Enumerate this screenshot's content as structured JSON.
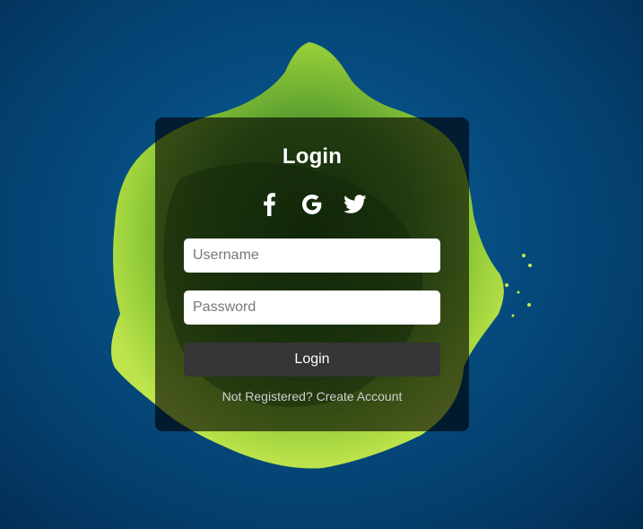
{
  "login_card": {
    "title": "Login",
    "social_icons": [
      "facebook-icon",
      "google-icon",
      "twitter-icon"
    ],
    "username": {
      "placeholder": "Username",
      "value": ""
    },
    "password": {
      "placeholder": "Password",
      "value": ""
    },
    "login_button_label": "Login",
    "register_prompt": "Not Registered?",
    "register_link_label": "Create Account"
  },
  "colors": {
    "background": "#064f84",
    "card": "rgba(0,0,0,0.62)",
    "button": "#353535",
    "accent_art": "#b8e33a"
  }
}
